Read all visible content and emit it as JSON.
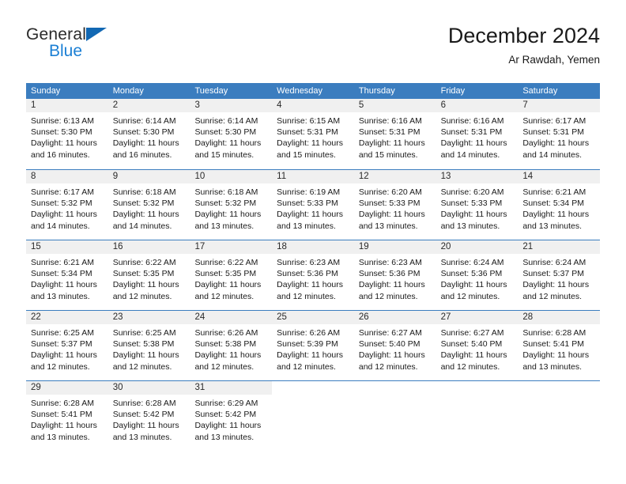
{
  "brand": {
    "name_top": "General",
    "name_bottom": "Blue",
    "triangle_color": "#1268b3",
    "blue_text_color": "#1b7fd4"
  },
  "header": {
    "title": "December 2024",
    "subtitle": "Ar Rawdah, Yemen"
  },
  "theme": {
    "header_bg": "#3b7dbf",
    "header_text": "#ffffff",
    "daynum_band_bg": "#f0f0f0",
    "row_divider": "#3b7dbf"
  },
  "calendar": {
    "weekdays": [
      "Sunday",
      "Monday",
      "Tuesday",
      "Wednesday",
      "Thursday",
      "Friday",
      "Saturday"
    ],
    "weeks": [
      [
        {
          "day": "1",
          "sunrise": "Sunrise: 6:13 AM",
          "sunset": "Sunset: 5:30 PM",
          "daylight": "Daylight: 11 hours and 16 minutes."
        },
        {
          "day": "2",
          "sunrise": "Sunrise: 6:14 AM",
          "sunset": "Sunset: 5:30 PM",
          "daylight": "Daylight: 11 hours and 16 minutes."
        },
        {
          "day": "3",
          "sunrise": "Sunrise: 6:14 AM",
          "sunset": "Sunset: 5:30 PM",
          "daylight": "Daylight: 11 hours and 15 minutes."
        },
        {
          "day": "4",
          "sunrise": "Sunrise: 6:15 AM",
          "sunset": "Sunset: 5:31 PM",
          "daylight": "Daylight: 11 hours and 15 minutes."
        },
        {
          "day": "5",
          "sunrise": "Sunrise: 6:16 AM",
          "sunset": "Sunset: 5:31 PM",
          "daylight": "Daylight: 11 hours and 15 minutes."
        },
        {
          "day": "6",
          "sunrise": "Sunrise: 6:16 AM",
          "sunset": "Sunset: 5:31 PM",
          "daylight": "Daylight: 11 hours and 14 minutes."
        },
        {
          "day": "7",
          "sunrise": "Sunrise: 6:17 AM",
          "sunset": "Sunset: 5:31 PM",
          "daylight": "Daylight: 11 hours and 14 minutes."
        }
      ],
      [
        {
          "day": "8",
          "sunrise": "Sunrise: 6:17 AM",
          "sunset": "Sunset: 5:32 PM",
          "daylight": "Daylight: 11 hours and 14 minutes."
        },
        {
          "day": "9",
          "sunrise": "Sunrise: 6:18 AM",
          "sunset": "Sunset: 5:32 PM",
          "daylight": "Daylight: 11 hours and 14 minutes."
        },
        {
          "day": "10",
          "sunrise": "Sunrise: 6:18 AM",
          "sunset": "Sunset: 5:32 PM",
          "daylight": "Daylight: 11 hours and 13 minutes."
        },
        {
          "day": "11",
          "sunrise": "Sunrise: 6:19 AM",
          "sunset": "Sunset: 5:33 PM",
          "daylight": "Daylight: 11 hours and 13 minutes."
        },
        {
          "day": "12",
          "sunrise": "Sunrise: 6:20 AM",
          "sunset": "Sunset: 5:33 PM",
          "daylight": "Daylight: 11 hours and 13 minutes."
        },
        {
          "day": "13",
          "sunrise": "Sunrise: 6:20 AM",
          "sunset": "Sunset: 5:33 PM",
          "daylight": "Daylight: 11 hours and 13 minutes."
        },
        {
          "day": "14",
          "sunrise": "Sunrise: 6:21 AM",
          "sunset": "Sunset: 5:34 PM",
          "daylight": "Daylight: 11 hours and 13 minutes."
        }
      ],
      [
        {
          "day": "15",
          "sunrise": "Sunrise: 6:21 AM",
          "sunset": "Sunset: 5:34 PM",
          "daylight": "Daylight: 11 hours and 13 minutes."
        },
        {
          "day": "16",
          "sunrise": "Sunrise: 6:22 AM",
          "sunset": "Sunset: 5:35 PM",
          "daylight": "Daylight: 11 hours and 12 minutes."
        },
        {
          "day": "17",
          "sunrise": "Sunrise: 6:22 AM",
          "sunset": "Sunset: 5:35 PM",
          "daylight": "Daylight: 11 hours and 12 minutes."
        },
        {
          "day": "18",
          "sunrise": "Sunrise: 6:23 AM",
          "sunset": "Sunset: 5:36 PM",
          "daylight": "Daylight: 11 hours and 12 minutes."
        },
        {
          "day": "19",
          "sunrise": "Sunrise: 6:23 AM",
          "sunset": "Sunset: 5:36 PM",
          "daylight": "Daylight: 11 hours and 12 minutes."
        },
        {
          "day": "20",
          "sunrise": "Sunrise: 6:24 AM",
          "sunset": "Sunset: 5:36 PM",
          "daylight": "Daylight: 11 hours and 12 minutes."
        },
        {
          "day": "21",
          "sunrise": "Sunrise: 6:24 AM",
          "sunset": "Sunset: 5:37 PM",
          "daylight": "Daylight: 11 hours and 12 minutes."
        }
      ],
      [
        {
          "day": "22",
          "sunrise": "Sunrise: 6:25 AM",
          "sunset": "Sunset: 5:37 PM",
          "daylight": "Daylight: 11 hours and 12 minutes."
        },
        {
          "day": "23",
          "sunrise": "Sunrise: 6:25 AM",
          "sunset": "Sunset: 5:38 PM",
          "daylight": "Daylight: 11 hours and 12 minutes."
        },
        {
          "day": "24",
          "sunrise": "Sunrise: 6:26 AM",
          "sunset": "Sunset: 5:38 PM",
          "daylight": "Daylight: 11 hours and 12 minutes."
        },
        {
          "day": "25",
          "sunrise": "Sunrise: 6:26 AM",
          "sunset": "Sunset: 5:39 PM",
          "daylight": "Daylight: 11 hours and 12 minutes."
        },
        {
          "day": "26",
          "sunrise": "Sunrise: 6:27 AM",
          "sunset": "Sunset: 5:40 PM",
          "daylight": "Daylight: 11 hours and 12 minutes."
        },
        {
          "day": "27",
          "sunrise": "Sunrise: 6:27 AM",
          "sunset": "Sunset: 5:40 PM",
          "daylight": "Daylight: 11 hours and 12 minutes."
        },
        {
          "day": "28",
          "sunrise": "Sunrise: 6:28 AM",
          "sunset": "Sunset: 5:41 PM",
          "daylight": "Daylight: 11 hours and 13 minutes."
        }
      ],
      [
        {
          "day": "29",
          "sunrise": "Sunrise: 6:28 AM",
          "sunset": "Sunset: 5:41 PM",
          "daylight": "Daylight: 11 hours and 13 minutes."
        },
        {
          "day": "30",
          "sunrise": "Sunrise: 6:28 AM",
          "sunset": "Sunset: 5:42 PM",
          "daylight": "Daylight: 11 hours and 13 minutes."
        },
        {
          "day": "31",
          "sunrise": "Sunrise: 6:29 AM",
          "sunset": "Sunset: 5:42 PM",
          "daylight": "Daylight: 11 hours and 13 minutes."
        },
        {
          "day": "",
          "sunrise": "",
          "sunset": "",
          "daylight": ""
        },
        {
          "day": "",
          "sunrise": "",
          "sunset": "",
          "daylight": ""
        },
        {
          "day": "",
          "sunrise": "",
          "sunset": "",
          "daylight": ""
        },
        {
          "day": "",
          "sunrise": "",
          "sunset": "",
          "daylight": ""
        }
      ]
    ]
  }
}
